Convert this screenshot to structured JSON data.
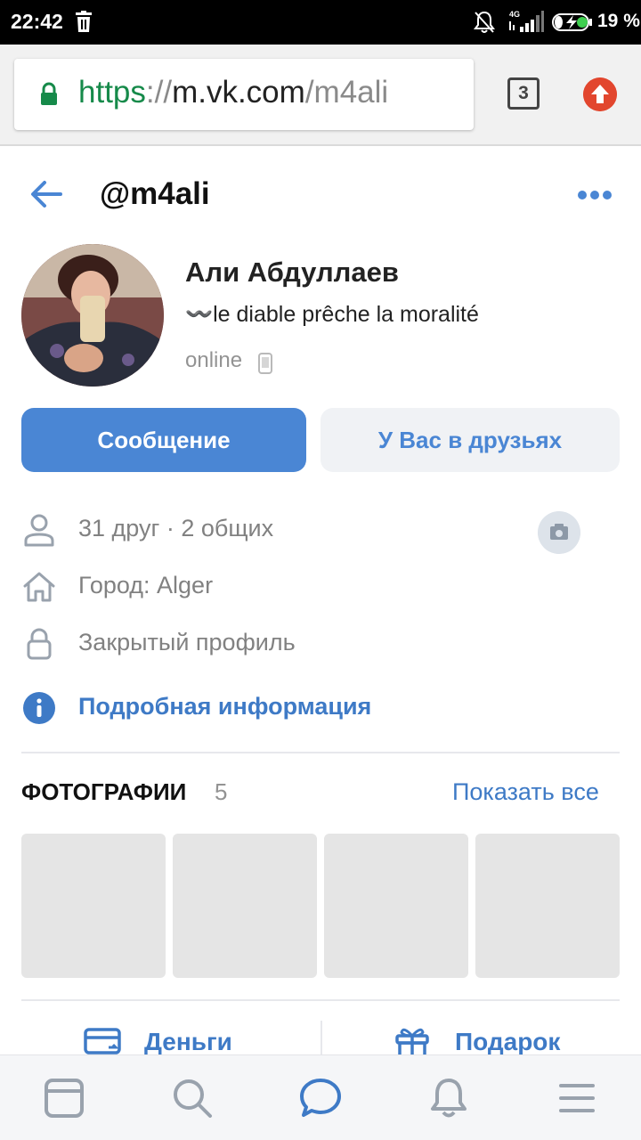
{
  "status_bar": {
    "time": "22:42",
    "battery": "19 %",
    "network": "4G"
  },
  "browser": {
    "url_scheme": "https",
    "url_sep": "://",
    "url_host": "m.vk.com",
    "url_path": "/m4ali",
    "tab_count": "3"
  },
  "profile": {
    "handle": "@m4ali",
    "name": "Али Абдуллаев",
    "status": "〰️le diable prêche la moralité",
    "online": "online"
  },
  "buttons": {
    "message": "Сообщение",
    "friends": "У Вас в друзьях"
  },
  "info": {
    "friends": "31 друг · 2 общих",
    "city": "Город: Alger",
    "closed": "Закрытый профиль",
    "details": "Подробная информация"
  },
  "photos": {
    "title": "ФОТОГРАФИИ",
    "count": "5",
    "show_all": "Показать все"
  },
  "actions": {
    "money": "Деньги",
    "gift": "Подарок"
  },
  "colors": {
    "accent": "#4a86d4",
    "link": "#3e7ac6",
    "muted": "#818181",
    "tile": "#e5e5e5"
  },
  "icons": {
    "nav": [
      "feed-icon",
      "search-icon",
      "messages-icon",
      "notifications-icon",
      "menu-icon"
    ]
  }
}
